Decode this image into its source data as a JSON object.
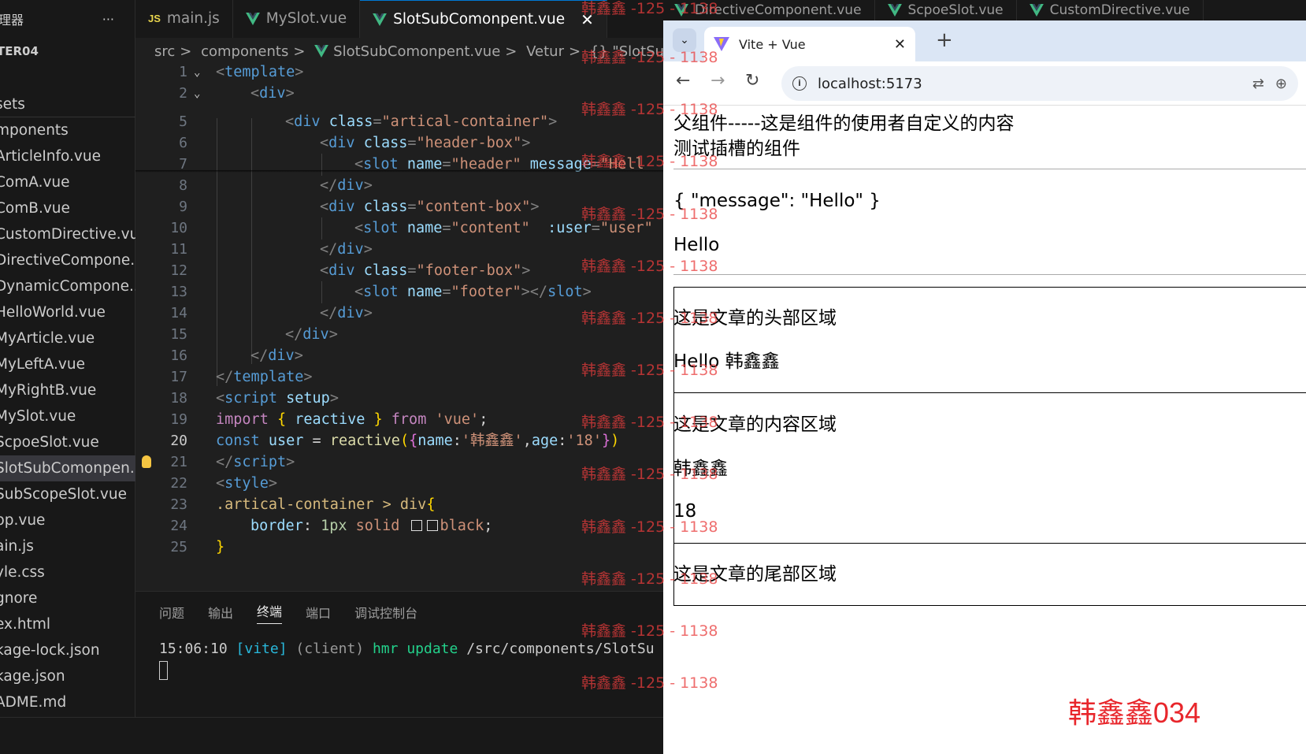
{
  "explorer": {
    "title": "理器",
    "more": "···",
    "project": "TER04",
    "files": [
      "sets",
      "mponents",
      "ArticleInfo.vue",
      "ComA.vue",
      "ComB.vue",
      "CustomDirective.vue",
      "DirectiveCompone...",
      "DynamicCompone...",
      "HelloWorld.vue",
      "MyArticle.vue",
      "MyLeftA.vue",
      "MyRightB.vue",
      "MySlot.vue",
      "ScpoeSlot.vue",
      "SlotSubComonpen...",
      "SubScopeSlot.vue",
      "pp.vue",
      "ain.js",
      "yle.css",
      "gnore",
      "ex.html",
      "kage-lock.json",
      "kage.json",
      "ADME.md"
    ]
  },
  "tabs": {
    "t1": "main.js",
    "t2": "MySlot.vue",
    "t3": "SlotSubComonpent.vue",
    "t4": "DirectiveComponent.vue",
    "t5": "ScpoeSlot.vue",
    "t6": "CustomDirective.vue",
    "js_badge": "JS",
    "close": "✕"
  },
  "breadcrumb": {
    "b1": "src",
    "b2": "components",
    "b3": "SlotSubComonpent.vue",
    "b4": "Vetur",
    "b5": "{} \"SlotSubCom",
    "sep": ">"
  },
  "line_numbers": [
    "1",
    "2",
    "5",
    "6",
    "7",
    "8",
    "9",
    "10",
    "11",
    "12",
    "13",
    "14",
    "15",
    "16",
    "17",
    "18",
    "19",
    "20",
    "21",
    "22",
    "23",
    "24",
    "25"
  ],
  "code": {
    "l1a": "<",
    "l1b": "template",
    "l1c": ">",
    "l2a": "<",
    "l2b": "div",
    "l2c": ">",
    "l5": "<div class=\"artical-container\">",
    "l5_tag": "div",
    "l5_attr": "class",
    "l5_val": "\"artical-container\"",
    "l6_tag": "div",
    "l6_attr": "class",
    "l6_val": "\"header-box\"",
    "l7_tag": "slot",
    "l7_a1": "name",
    "l7_v1": "\"header\"",
    "l7_a2": "message",
    "l7_v2": "\"Hell",
    "l8_tag": "div",
    "l9_tag": "div",
    "l9_attr": "class",
    "l9_val": "\"content-box\"",
    "l10_tag": "slot",
    "l10_a1": "name",
    "l10_v1": "\"content\"",
    "l10_a2": ":user",
    "l10_v2": "\"user\"",
    "l11_tag": "div",
    "l12_tag": "div",
    "l12_attr": "class",
    "l12_val": "\"footer-box\"",
    "l13_tag": "slot",
    "l13_a1": "name",
    "l13_v1": "\"footer\"",
    "l13_end": "slot",
    "l14_tag": "div",
    "l15_tag": "div",
    "l16_tag": "div",
    "l17_tag": "template",
    "l18_tag": "script",
    "l18_attr": "setup",
    "l19_kw": "import",
    "l19_name": "reactive",
    "l19_from": "from",
    "l19_str": "'vue'",
    "l20_kw": "const",
    "l20_var": "user",
    "l20_fn": "reactive",
    "l20_k1": "name",
    "l20_v1": "'韩鑫鑫'",
    "l20_k2": "age",
    "l20_v2": "'18'",
    "l21_tag": "script",
    "l22_tag": "style",
    "l23_sel": ".artical-container",
    "l23_op": ">",
    "l23_el": "div",
    "l24_prop": "border",
    "l24_v1": "1px",
    "l24_v2": "solid",
    "l24_v3": "black",
    "l25": "}"
  },
  "panel": {
    "tabs": [
      "问题",
      "输出",
      "终端",
      "端口",
      "调试控制台"
    ],
    "active": "终端",
    "term_time": "15:06:10",
    "term_vite": "[vite]",
    "term_client": "(client)",
    "term_hmr": "hmr update",
    "term_path": "/src/components/SlotSu"
  },
  "browser": {
    "tab_title": "Vite + Vue",
    "tab_close": "✕",
    "new_tab": "+",
    "url": "localhost:5173",
    "back": "←",
    "forward": "→",
    "reload": "↻",
    "dropdown": "⌄"
  },
  "page": {
    "line1": "父组件-----这是组件的使用者自定义的内容",
    "line2": "测试插槽的组件",
    "json": "{ \"message\": \"Hello\" }",
    "hello": "Hello",
    "header_area": "这是文章的头部区域",
    "hello_name": "Hello 韩鑫鑫",
    "content_area": "这是文章的内容区域",
    "name": "韩鑫鑫",
    "age": "18",
    "footer_area": "这是文章的尾部区域",
    "signature": "韩鑫鑫034"
  },
  "watermark": "韩鑫鑫 -125 - 1138",
  "colors": {
    "accent": "#0078d4",
    "watermark": "#e83c3c",
    "signature": "#e8262b"
  }
}
